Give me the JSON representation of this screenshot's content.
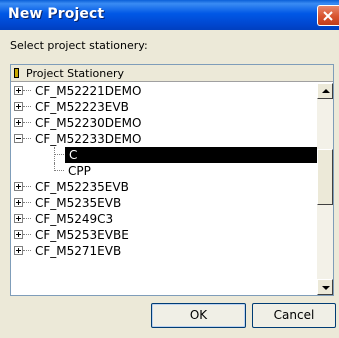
{
  "window": {
    "title": "New Project"
  },
  "prompt": "Select project stationery:",
  "tree": {
    "header_label": "Project Stationery",
    "items": [
      {
        "label": "CF_M52221DEMO",
        "level": 0,
        "expanded": false
      },
      {
        "label": "CF_M52223EVB",
        "level": 0,
        "expanded": false
      },
      {
        "label": "CF_M52230DEMO",
        "level": 0,
        "expanded": false
      },
      {
        "label": "CF_M52233DEMO",
        "level": 0,
        "expanded": true
      },
      {
        "label": "C",
        "level": 1,
        "selected": true
      },
      {
        "label": "CPP",
        "level": 1,
        "selected": false
      },
      {
        "label": "CF_M52235EVB",
        "level": 0,
        "expanded": false
      },
      {
        "label": "CF_M5235EVB",
        "level": 0,
        "expanded": false
      },
      {
        "label": "CF_M5249C3",
        "level": 0,
        "expanded": false
      },
      {
        "label": "CF_M5253EVBE",
        "level": 0,
        "expanded": false
      },
      {
        "label": "CF_M5271EVB",
        "level": 0,
        "expanded": false
      }
    ]
  },
  "buttons": {
    "ok": "OK",
    "cancel": "Cancel"
  },
  "colors": {
    "title_bar": "#0055e5",
    "selection": "#000000"
  }
}
